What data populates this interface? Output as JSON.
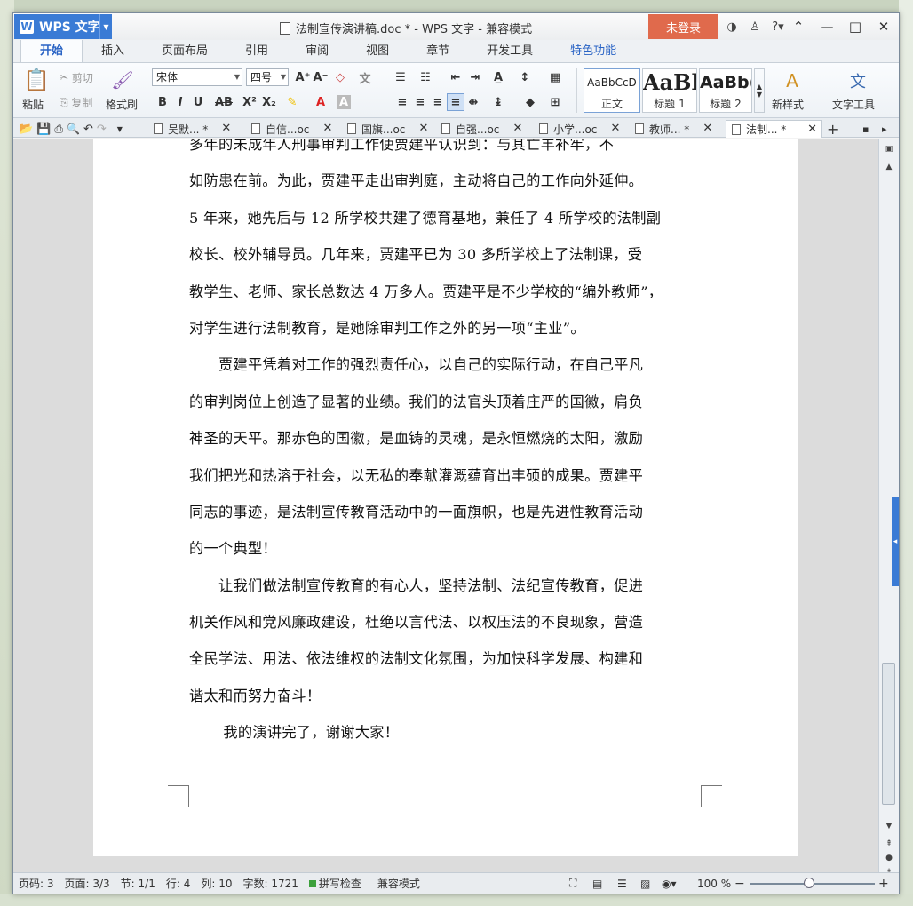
{
  "app": {
    "name": "WPS 文字",
    "title": "法制宣传演讲稿.doc * - WPS 文字 - 兼容模式",
    "login": "未登录"
  },
  "ribbon_tabs": [
    "开始",
    "插入",
    "页面布局",
    "引用",
    "审阅",
    "视图",
    "章节",
    "开发工具",
    "特色功能"
  ],
  "toolbar": {
    "paste": "粘贴",
    "cut": "剪切",
    "copy": "复制",
    "format_painter": "格式刷",
    "font": "宋体",
    "size": "四号",
    "styles": [
      {
        "preview": "AaBbCcD",
        "name": "正文"
      },
      {
        "preview": "AaBl",
        "name": "标题 1"
      },
      {
        "preview": "AaBb(",
        "name": "标题 2"
      }
    ],
    "new_style": "新样式",
    "text_tools": "文字工具"
  },
  "doc_tabs": [
    "吴默... *",
    "自信...oc",
    "国旗...oc",
    "自强...oc",
    "小学...oc",
    "教师... *",
    "法制... *"
  ],
  "document": {
    "lines": [
      "多年的未成年人刑事审判工作使贾建平认识到：与其亡羊补牢，不",
      "如防患在前。为此，贾建平走出审判庭，主动将自己的工作向外延伸。",
      "5 年来，她先后与 12 所学校共建了德育基地，兼任了 4 所学校的法制副",
      "校长、校外辅导员。几年来，贾建平已为 30 多所学校上了法制课，受",
      "教学生、老师、家长总数达 4 万多人。贾建平是不少学校的“编外教师”，",
      "对学生进行法制教育，是她除审判工作之外的另一项“主业”。",
      "　　贾建平凭着对工作的强烈责任心，以自己的实际行动，在自己平凡",
      "的审判岗位上创造了显著的业绩。我们的法官头顶着庄严的国徽，肩负",
      "神圣的天平。那赤色的国徽，是血铸的灵魂，是永恒燃烧的太阳，激励",
      "我们把光和热溶于社会，以无私的奉献灌溉蕴育出丰硕的成果。贾建平",
      "同志的事迹，是法制宣传教育活动中的一面旗帜，也是先进性教育活动",
      "的一个典型！",
      "　　让我们做法制宣传教育的有心人，坚持法制、法纪宣传教育，促进",
      "机关作风和党风廉政建设，杜绝以言代法、以权压法的不良现象，营造",
      "全民学法、用法、依法维权的法制文化氛围，为加快科学发展、构建和",
      "谐太和而努力奋斗！",
      "　　 我的演讲完了，谢谢大家！"
    ]
  },
  "status": {
    "page_num": "页码: 3",
    "pages": "页面: 3/3",
    "section": "节: 1/1",
    "row": "行: 4",
    "col": "列: 10",
    "words": "字数: 1721",
    "spell": "拼写检查",
    "mode": "兼容模式",
    "zoom": "100 %"
  }
}
